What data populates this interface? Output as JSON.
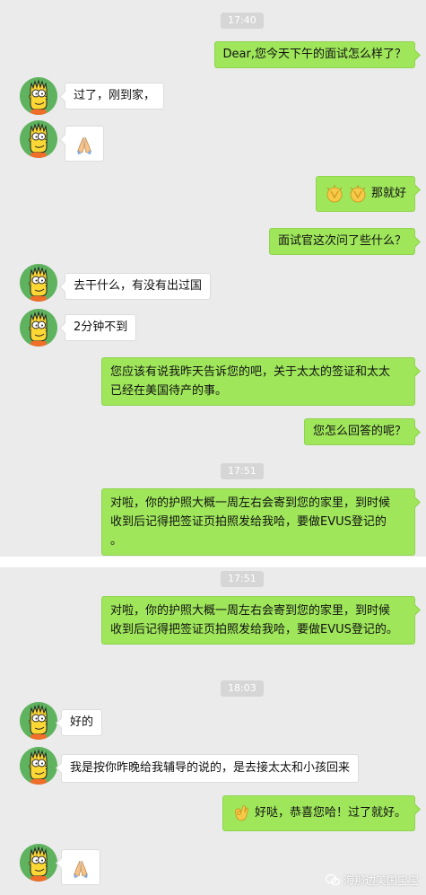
{
  "messages": {
    "t1": "17:40",
    "m1": "Dear,您今天下午的面试怎么样了？",
    "m2": "过了，刚到家，",
    "m4_text": "那就好",
    "m5": "面试官这次问了些什么？",
    "m6": "去干什么，有没有出过国",
    "m7": "2分钟不到",
    "m8_l1": "您应该有说我昨天告诉您的吧，关于太太的签证和太太",
    "m8_l2": "已经在美国待产的事。",
    "m9": "您怎么回答的呢？",
    "t2": "17:51",
    "m10_l1": "对啦，你的护照大概一周左右会寄到您的家里，到时候",
    "m10_l2": "收到后记得把签证页拍照发给我哈，要做EVUS登记的",
    "m10_l3": "。",
    "t3": "17:51",
    "m11_l1": "对啦，你的护照大概一周左右会寄到您的家里，到时候",
    "m11_l2": "收到后记得把签证页拍照发给我哈，要做EVUS登记的。",
    "t4": "18:03",
    "m12": "好的",
    "m13": "我是按你昨晚给我辅导的说的，是去接太太和小孩回来",
    "m14": "好哒，恭喜您哈！过了就好。"
  },
  "watermark": "海那边美国宝宝",
  "colors": {
    "background": "#ebebeb",
    "sent_bubble": "#9fe65b",
    "received_bubble": "#ffffff",
    "avatar_bg": "#5fb35f",
    "bart_yellow": "#fdd835"
  }
}
